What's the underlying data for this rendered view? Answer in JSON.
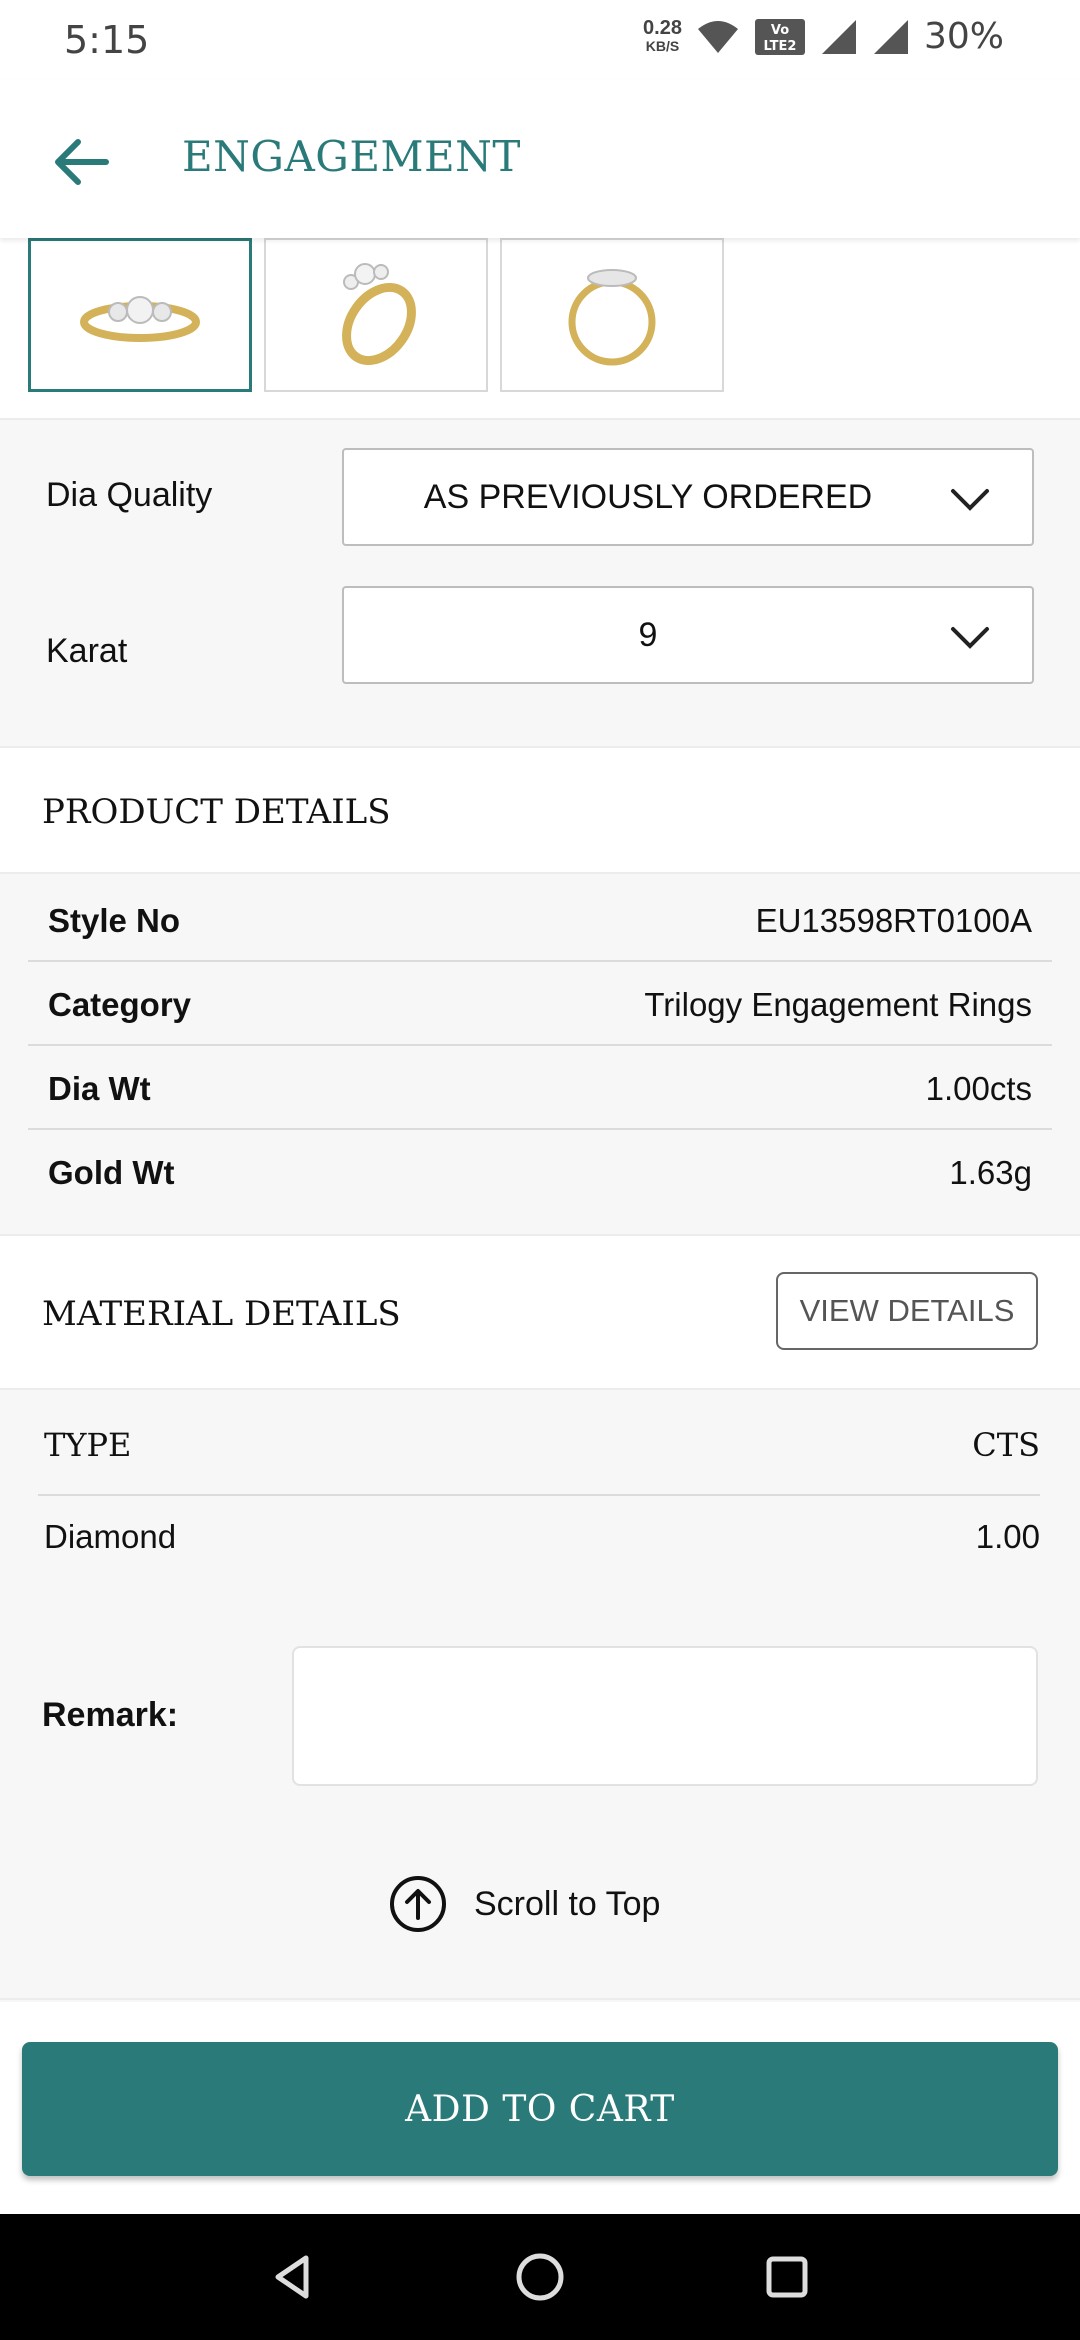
{
  "status_bar": {
    "time": "5:15",
    "net_speed_value": "0.28",
    "net_speed_unit": "KB/S",
    "battery": "30%",
    "icons": [
      "wifi-icon",
      "volte-icon",
      "signal-icon",
      "signal-icon"
    ]
  },
  "header": {
    "back_icon": "arrow-left-icon",
    "title": "ENGAGEMENT"
  },
  "gallery": {
    "selected_index": 0,
    "thumbnails": [
      "ring-front-view",
      "ring-angled-view",
      "ring-side-view"
    ]
  },
  "options": {
    "dia_quality_label": "Dia Quality",
    "dia_quality_value": "AS PREVIOUSLY ORDERED",
    "karat_label": "Karat",
    "karat_value": "9"
  },
  "product_details": {
    "heading": "PRODUCT DETAILS",
    "rows": [
      {
        "label": "Style No",
        "value": "EU13598RT0100A"
      },
      {
        "label": "Category",
        "value": "Trilogy Engagement Rings"
      },
      {
        "label": "Dia Wt",
        "value": "1.00cts"
      },
      {
        "label": "Gold Wt",
        "value": "1.63g"
      }
    ]
  },
  "material_details": {
    "heading": "MATERIAL DETAILS",
    "view_button": "VIEW DETAILS",
    "col_type": "TYPE",
    "col_cts": "CTS",
    "rows": [
      {
        "type": "Diamond",
        "cts": "1.00"
      }
    ]
  },
  "remark": {
    "label": "Remark:",
    "value": ""
  },
  "scroll_top": {
    "label": "Scroll to Top",
    "icon": "arrow-up-circle-icon"
  },
  "cart": {
    "button": "ADD TO CART"
  },
  "colors": {
    "accent": "#2a7a7a",
    "background": "#f7f7f7",
    "surface": "#ffffff"
  }
}
